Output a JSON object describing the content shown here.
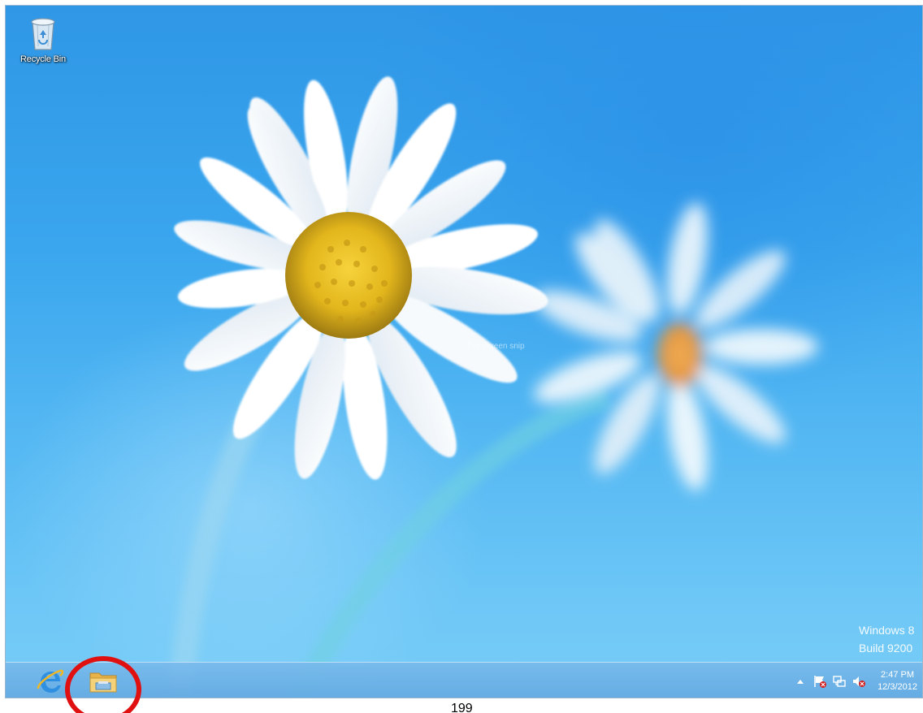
{
  "desktop": {
    "icons": [
      {
        "label": "Recycle Bin",
        "icon": "recycle-bin-icon"
      }
    ],
    "faint_text": "Full-screen snip",
    "watermark": {
      "line1": "Windows 8",
      "line2": "Build 9200"
    }
  },
  "taskbar": {
    "pinned": [
      {
        "app": "Internet Explorer",
        "icon": "internet-explorer-icon"
      },
      {
        "app": "File Explorer",
        "icon": "file-explorer-icon"
      }
    ],
    "tray": {
      "icons": [
        "show-hidden-icons-arrow",
        "action-center-flag-icon",
        "network-icon",
        "volume-muted-icon"
      ],
      "time": "2:47 PM",
      "date": "12/3/2012"
    }
  },
  "annotation": {
    "color": "#e01010",
    "target": "File Explorer"
  },
  "page_number": "199",
  "colors": {
    "wallpaper_blue": "#3aa6ee",
    "taskbar": "#6aaee3",
    "annotation_red": "#e01010"
  }
}
